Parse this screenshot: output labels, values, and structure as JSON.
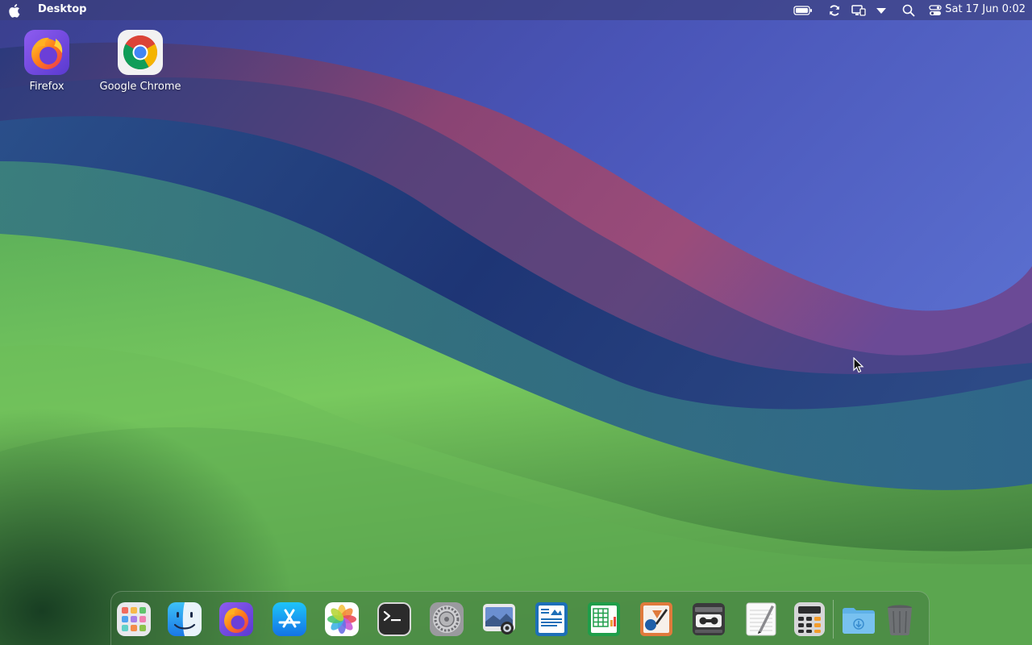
{
  "menubar": {
    "title": "Desktop",
    "clock": "Sat 17 Jun  0:02",
    "icons": [
      "apple-logo-icon",
      "battery-icon",
      "sync-icon",
      "display-icon",
      "dropdown-triangle-icon",
      "search-icon",
      "control-center-icon"
    ]
  },
  "desktop": {
    "icons": [
      {
        "label": "Firefox",
        "icon": "firefox-icon"
      },
      {
        "label": "Google Chrome",
        "icon": "chrome-icon"
      }
    ]
  },
  "dock": {
    "apps": [
      "launchpad-icon",
      "finder-icon",
      "firefox-icon",
      "app-store-icon",
      "photos-icon",
      "terminal-icon",
      "system-settings-icon",
      "screenshot-icon",
      "writer-icon",
      "calc-icon",
      "draw-icon",
      "tape-recorder-icon",
      "text-editor-icon",
      "calculator-icon",
      "downloads-folder-icon",
      "trash-icon"
    ]
  },
  "colors": {
    "sky_blue": "#5b67c9",
    "deep_blue": "#1f2f6b",
    "magenta_band": "#8a4a7a",
    "green_hill": "#72c256",
    "dark_green": "#1e4a2a"
  }
}
